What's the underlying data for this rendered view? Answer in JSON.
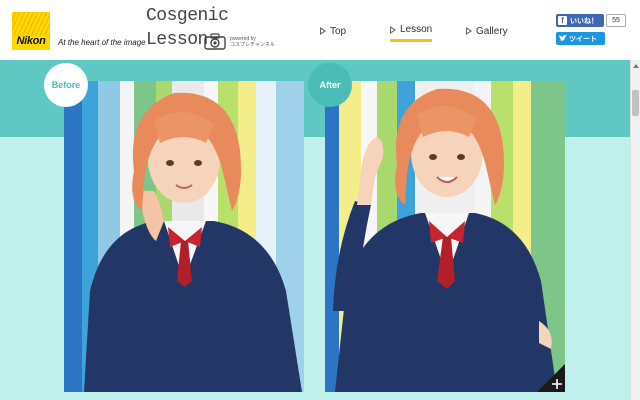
{
  "header": {
    "logo_text": "Nikon",
    "tagline": "At the heart of the image",
    "brand_line1": "Cosgenic",
    "brand_line2": "Lesson",
    "powered_line1": "powered by",
    "powered_line2": "コスプレチャンネル"
  },
  "nav": {
    "items": [
      {
        "label": "Top",
        "active": false
      },
      {
        "label": "Lesson",
        "active": true
      },
      {
        "label": "Gallery",
        "active": false
      }
    ]
  },
  "social": {
    "like_label": "いいね！",
    "like_count": "55",
    "tweet_label": "ツイート"
  },
  "comparison": {
    "before_label": "Before",
    "after_label": "After"
  },
  "colors": {
    "accent_teal": "#5fc8c2",
    "light_teal": "#bff0ec",
    "nav_underline": "#f0c419",
    "facebook": "#4267b2",
    "twitter": "#1b95e0"
  },
  "icons": [
    "camera-icon",
    "play-triangle-icon",
    "facebook-icon",
    "twitter-icon",
    "expand-plus-icon",
    "scroll-up-icon"
  ]
}
